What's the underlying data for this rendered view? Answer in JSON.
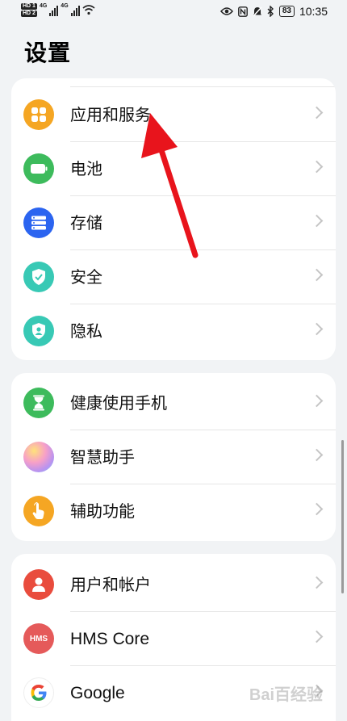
{
  "status_bar": {
    "hd_top": "HD 1",
    "hd_bottom": "HD 2",
    "net1": "4G",
    "net2": "4G",
    "battery": "83",
    "time": "10:35"
  },
  "page": {
    "title": "设置"
  },
  "groups": [
    {
      "items": [
        {
          "label": "应用和服务",
          "icon": "apps-icon",
          "color": "#f5a623"
        },
        {
          "label": "电池",
          "icon": "battery-icon",
          "color": "#3dbb5c"
        },
        {
          "label": "存储",
          "icon": "storage-icon",
          "color": "#2b64f0"
        },
        {
          "label": "安全",
          "icon": "shield-check-icon",
          "color": "#38c9b5"
        },
        {
          "label": "隐私",
          "icon": "privacy-icon",
          "color": "#38c9b5"
        }
      ]
    },
    {
      "items": [
        {
          "label": "健康使用手机",
          "icon": "hourglass-icon",
          "color": "#3dbb5c"
        },
        {
          "label": "智慧助手",
          "icon": "assistant-icon",
          "color": "#d88bd8"
        },
        {
          "label": "辅助功能",
          "icon": "hand-icon",
          "color": "#f5a623"
        }
      ]
    },
    {
      "items": [
        {
          "label": "用户和帐户",
          "icon": "user-icon",
          "color": "#e94c3d"
        },
        {
          "label": "HMS Core",
          "icon": "hms-icon",
          "color": "#e55a5a",
          "icon_text": "HMS"
        },
        {
          "label": "Google",
          "icon": "google-icon",
          "color": "#ffffff"
        }
      ]
    }
  ],
  "watermark": "Bai百经验",
  "colors": {
    "background": "#f1f3f5",
    "arrow": "#e8141c"
  }
}
